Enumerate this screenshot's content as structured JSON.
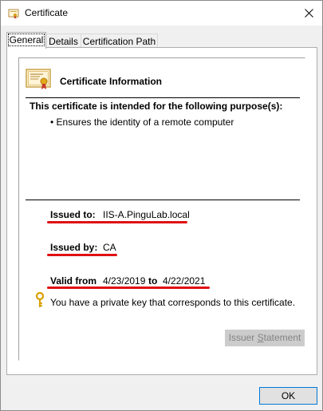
{
  "window": {
    "title": "Certificate",
    "icon": "certificate-icon",
    "close_icon": "close-icon"
  },
  "tabs": [
    {
      "label": "General",
      "active": true
    },
    {
      "label": "Details",
      "active": false
    },
    {
      "label": "Certification Path",
      "active": false
    }
  ],
  "general": {
    "info_title": "Certificate Information",
    "purpose_heading": "This certificate is intended for the following purpose(s):",
    "purposes": [
      "• Ensures the identity of a remote computer"
    ],
    "issued_to_label": "Issued to:",
    "issued_to_value": "IIS-A.PinguLab.local",
    "issued_by_label": "Issued by:",
    "issued_by_value": "CA",
    "valid_from_label": "Valid from",
    "valid_from_value": "4/23/2019",
    "valid_to_label": "to",
    "valid_to_value": "4/22/2021",
    "private_key_text": "You have a private key that corresponds to this certificate.",
    "key_icon": "key-icon"
  },
  "buttons": {
    "issuer_statement_pre": "Issuer ",
    "issuer_statement_u": "S",
    "issuer_statement_post": "tatement",
    "ok": "OK"
  },
  "colors": {
    "annotation_underline": "#e01010",
    "ok_focus_border": "#0078d7",
    "disabled_text": "#838383"
  }
}
